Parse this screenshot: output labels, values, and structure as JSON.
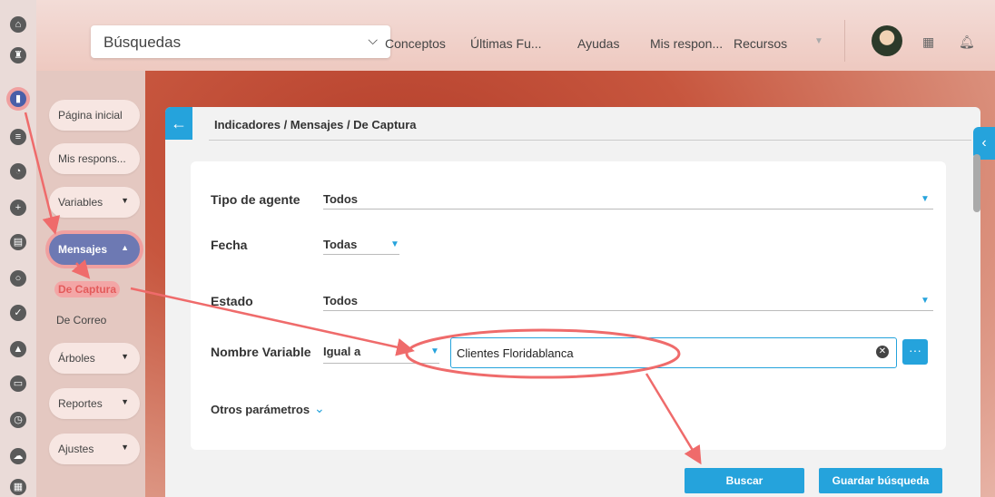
{
  "topbar": {
    "search_label": "Búsquedas",
    "nav": [
      "Conceptos",
      "Últimas Fu...",
      "Ayudas",
      "Mis respon...",
      "Recursos"
    ]
  },
  "sidebar": {
    "items": [
      {
        "label": "Página inicial"
      },
      {
        "label": "Mis respons..."
      },
      {
        "label": "Variables"
      },
      {
        "label": "Mensajes"
      },
      {
        "label": "Árboles"
      },
      {
        "label": "Reportes"
      },
      {
        "label": "Ajustes"
      }
    ],
    "sub_items": [
      "De Captura",
      "De Correo"
    ]
  },
  "panel": {
    "breadcrumb": "Indicadores / Mensajes / De Captura"
  },
  "form": {
    "tipo_agente_label": "Tipo de agente",
    "tipo_agente_value": "Todos",
    "fecha_label": "Fecha",
    "fecha_value": "Todas",
    "estado_label": "Estado",
    "estado_value": "Todos",
    "nombre_variable_label": "Nombre Variable",
    "operator_value": "Igual a",
    "variable_value": "Clientes Floridablanca",
    "otros_label": "Otros parámetros"
  },
  "buttons": {
    "buscar": "Buscar",
    "guardar": "Guardar búsqueda"
  },
  "colors": {
    "accent": "#25a3dc",
    "annotation": "#ef6b6b"
  }
}
